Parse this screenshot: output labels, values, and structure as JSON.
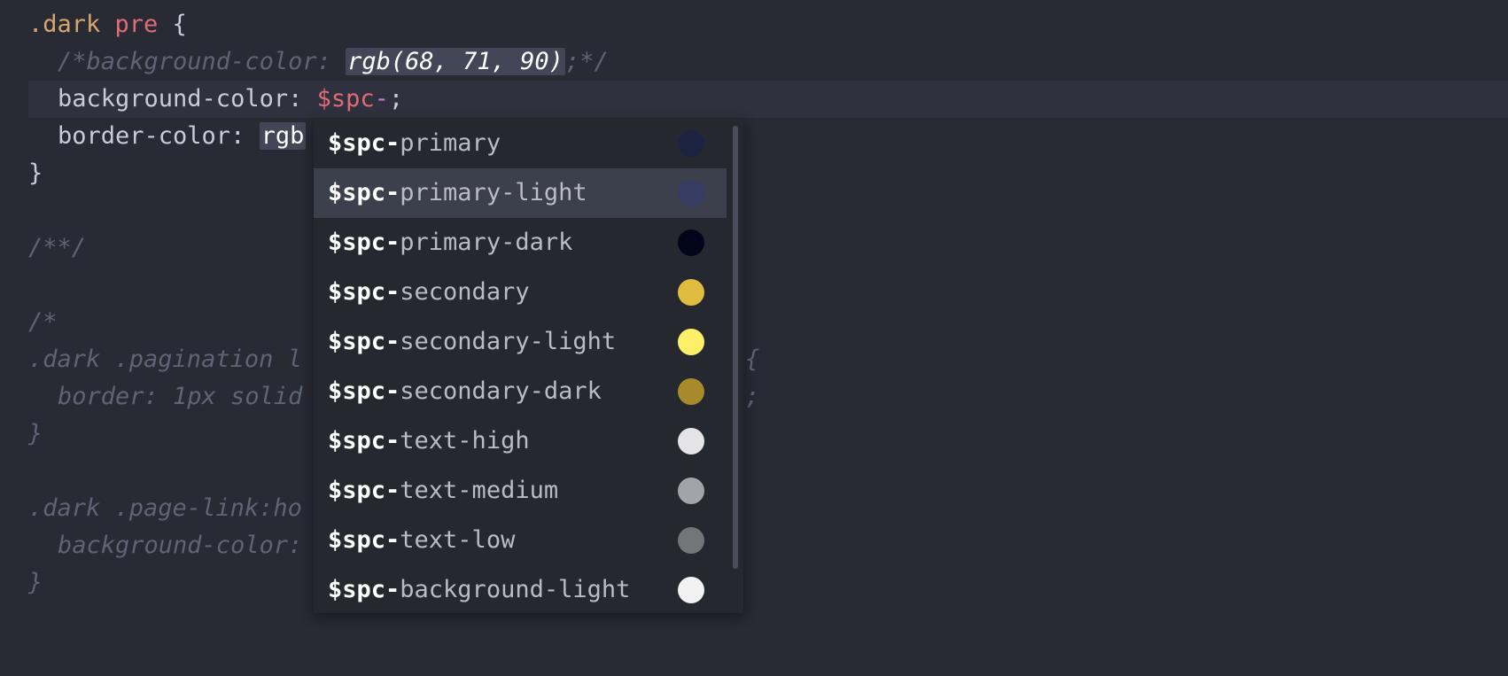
{
  "editor": {
    "line1": {
      "cls": ".dark",
      "sel": "pre",
      "brace": "{"
    },
    "line2": {
      "open": "/*background-color: ",
      "value": "rgb(68, 71, 90)",
      "close": ";*/"
    },
    "line3": {
      "prop": "background-color: ",
      "var": "$spc",
      "dash": "-",
      "semi": ";"
    },
    "line4": {
      "prop": "border-color: ",
      "value": "rgb"
    },
    "line5": {
      "brace": "}"
    },
    "line7": {
      "text": "/**/"
    },
    "line9": {
      "text": "/*"
    },
    "line10": {
      "left": ".dark .pagination l",
      "right": "{"
    },
    "line11": {
      "left": "border: 1px solid",
      "right": ";"
    },
    "line12": {
      "text": "}"
    },
    "line14": {
      "text": ".dark .page-link:ho"
    },
    "line15": {
      "text": "background-color:"
    },
    "line16": {
      "text": "}"
    }
  },
  "autocomplete": {
    "match_prefix": "$spc-",
    "selected_index": 1,
    "items": [
      {
        "rest": "primary",
        "color": "#1b2340"
      },
      {
        "rest": "primary-light",
        "color": "#363c62"
      },
      {
        "rest": "primary-dark",
        "color": "#03051a"
      },
      {
        "rest": "secondary",
        "color": "#e0bd3e"
      },
      {
        "rest": "secondary-light",
        "color": "#fdef68"
      },
      {
        "rest": "secondary-dark",
        "color": "#a98a2a"
      },
      {
        "rest": "text-high",
        "color": "#e4e4e6"
      },
      {
        "rest": "text-medium",
        "color": "#a3a4a9"
      },
      {
        "rest": "text-low",
        "color": "#747579"
      },
      {
        "rest": "background-light",
        "color": "#f2f2f3"
      }
    ]
  },
  "colors": {
    "background": "#282a34",
    "active_line": "#2f323e",
    "popup_bg": "#262830",
    "selected_item": "#3c3f4c"
  }
}
